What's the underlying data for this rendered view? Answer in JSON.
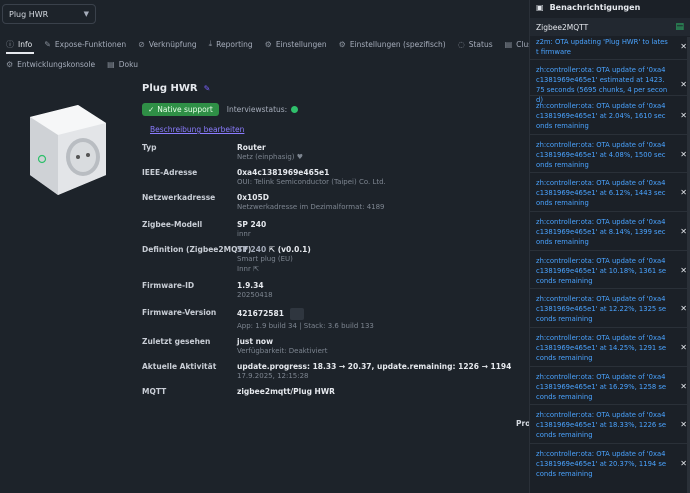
{
  "device_select": {
    "value": "Plug HWR"
  },
  "tabs_row1": [
    {
      "label": "Info",
      "icon": "info-icon",
      "glyph": "ⓘ"
    },
    {
      "label": "Expose-Funktionen",
      "icon": "pencil-icon",
      "glyph": "✎"
    },
    {
      "label": "Verknüpfung",
      "icon": "link-icon",
      "glyph": "⊘"
    },
    {
      "label": "Reporting",
      "icon": "download-icon",
      "glyph": "⤓"
    },
    {
      "label": "Einstellungen",
      "icon": "gears-icon",
      "glyph": "⚙"
    },
    {
      "label": "Einstellungen (spezifisch)",
      "icon": "gear-icon",
      "glyph": "⚙"
    },
    {
      "label": "Status",
      "icon": "status-icon",
      "glyph": "◌"
    },
    {
      "label": "Cluster",
      "icon": "cluster-icon",
      "glyph": "▤"
    }
  ],
  "tabs_row2": [
    {
      "label": "Entwicklungskonsole",
      "icon": "console-icon",
      "glyph": "⚙"
    },
    {
      "label": "Doku",
      "icon": "doc-icon",
      "glyph": "▤"
    }
  ],
  "device": {
    "title": "Plug HWR",
    "badge": "Native support",
    "interview_label": "Interviewstatus:",
    "desc_link": "Beschreibung bearbeiten"
  },
  "props": {
    "type": {
      "k": "Typ",
      "v": "Router",
      "s": "Netz (einphasig)"
    },
    "ieee": {
      "k": "IEEE-Adresse",
      "v": "0xa4c1381969e465e1",
      "s": "OUI: Telink Semiconductor (Taipei) Co. Ltd."
    },
    "nwk": {
      "k": "Netzwerkadresse",
      "v": "0x105D",
      "s": "Netzwerkadresse im Dezimalformat: 4189"
    },
    "model": {
      "k": "Zigbee-Modell",
      "v": "SP 240",
      "s": "innr"
    },
    "definition": {
      "k": "Definition (Zigbee2MQTT)",
      "v": "SP 240",
      "v_extra": "(v0.0.1)",
      "s": "Smart plug (EU)",
      "s2": "Innr"
    },
    "fw_id": {
      "k": "Firmware-ID",
      "v": "1.9.34",
      "s": "20250418"
    },
    "fw_ver": {
      "k": "Firmware-Version",
      "v": "421672581",
      "s": "App: 1.9 build 34 | Stack: 3.6 build 133"
    },
    "last_seen": {
      "k": "Zuletzt gesehen",
      "v": "just now",
      "s": "Verfügbarkeit: Deaktiviert"
    },
    "activity": {
      "k": "Aktuelle Aktivität",
      "v": "update.progress: 18.33 → 20.37, update.remaining: 1226 → 1194",
      "s": "17.9.2025, 12:15:28"
    },
    "mqtt": {
      "k": "MQTT",
      "v": "zigbee2mqtt/Plug HWR"
    }
  },
  "truncated_label": "Prol",
  "notifications": {
    "header": "Benachrichtigungen",
    "source": "Zigbee2MQTT",
    "items": [
      "z2m: OTA updating 'Plug HWR' to latest firmware",
      "zh:controller:ota: OTA update of '0xa4c1381969e465e1' estimated at 1423.75 seconds (5695 chunks, 4 per second)",
      "zh:controller:ota: OTA update of '0xa4c1381969e465e1' at 2.04%, 1610 seconds remaining",
      "zh:controller:ota: OTA update of '0xa4c1381969e465e1' at 4.08%, 1500 seconds remaining",
      "zh:controller:ota: OTA update of '0xa4c1381969e465e1' at 6.12%, 1443 seconds remaining",
      "zh:controller:ota: OTA update of '0xa4c1381969e465e1' at 8.14%, 1399 seconds remaining",
      "zh:controller:ota: OTA update of '0xa4c1381969e465e1' at 10.18%, 1361 seconds remaining",
      "zh:controller:ota: OTA update of '0xa4c1381969e465e1' at 12.22%, 1325 seconds remaining",
      "zh:controller:ota: OTA update of '0xa4c1381969e465e1' at 14.25%, 1291 seconds remaining",
      "zh:controller:ota: OTA update of '0xa4c1381969e465e1' at 16.29%, 1258 seconds remaining",
      "zh:controller:ota: OTA update of '0xa4c1381969e465e1' at 18.33%, 1226 seconds remaining",
      "zh:controller:ota: OTA update of '0xa4c1381969e465e1' at 20.37%, 1194 seconds remaining"
    ]
  }
}
